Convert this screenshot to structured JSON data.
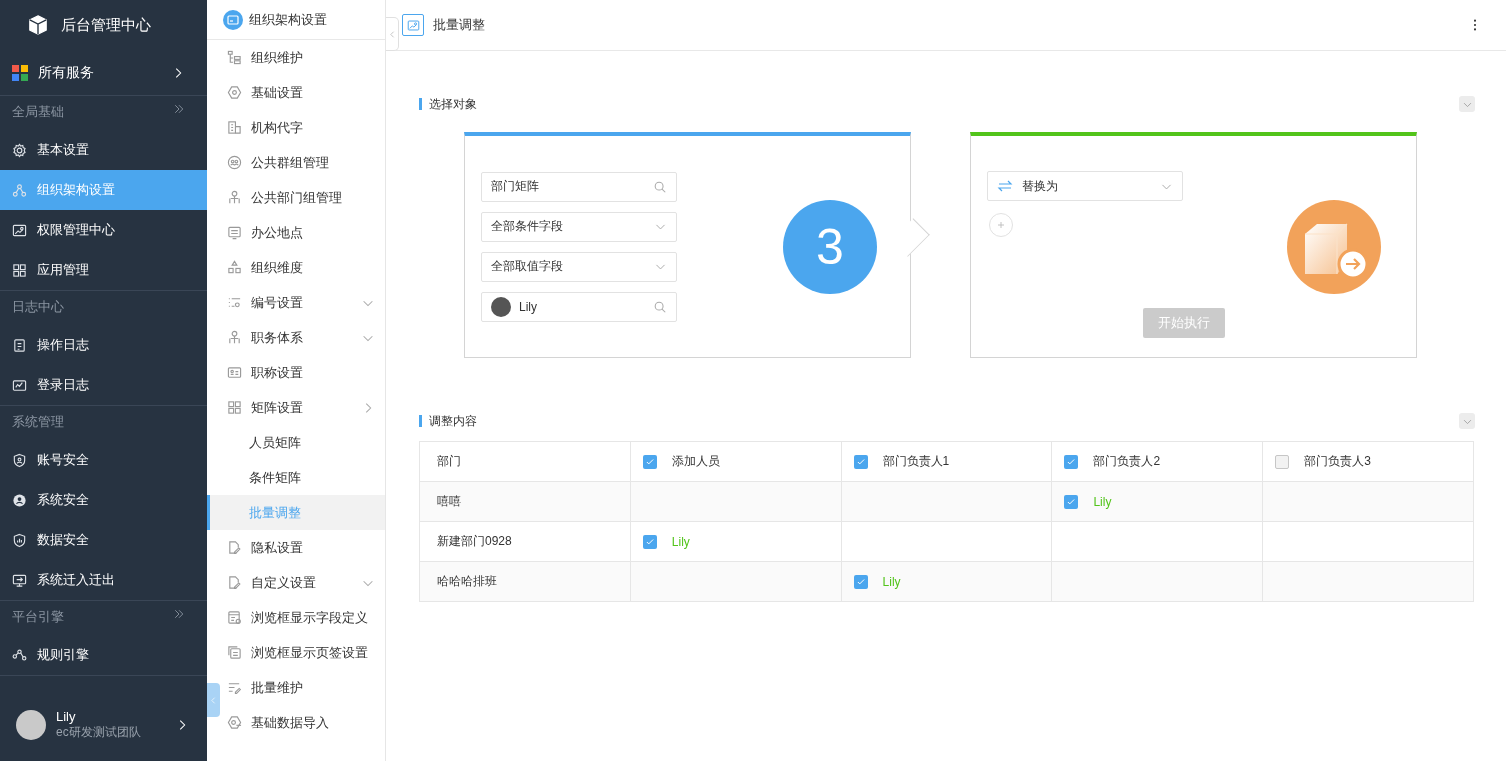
{
  "sidebar": {
    "title": "后台管理中心",
    "services": {
      "label": "所有服务"
    },
    "groups": [
      {
        "label": "全局基础",
        "items": [
          {
            "label": "基本设置",
            "selected": false
          },
          {
            "label": "组织架构设置",
            "selected": true
          },
          {
            "label": "权限管理中心",
            "selected": false
          },
          {
            "label": "应用管理",
            "selected": false
          }
        ]
      },
      {
        "label": "日志中心",
        "items": [
          {
            "label": "操作日志",
            "selected": false
          },
          {
            "label": "登录日志",
            "selected": false
          }
        ]
      },
      {
        "label": "系统管理",
        "items": [
          {
            "label": "账号安全",
            "selected": false
          },
          {
            "label": "系统安全",
            "selected": false
          },
          {
            "label": "数据安全",
            "selected": false
          },
          {
            "label": "系统迁入迁出",
            "selected": false
          }
        ]
      },
      {
        "label": "平台引擎",
        "items": [
          {
            "label": "规则引擎",
            "selected": false
          }
        ]
      }
    ],
    "user": {
      "name": "Lily",
      "team": "ec研发测试团队"
    }
  },
  "submenu": {
    "title": "组织架构设置",
    "items": [
      {
        "label": "组织维护",
        "selected": false
      },
      {
        "label": "基础设置",
        "selected": false
      },
      {
        "label": "机构代字",
        "selected": false
      },
      {
        "label": "公共群组管理",
        "selected": false
      },
      {
        "label": "公共部门组管理",
        "selected": false
      },
      {
        "label": "办公地点",
        "selected": false
      },
      {
        "label": "组织维度",
        "selected": false
      },
      {
        "label": "编号设置",
        "selected": false,
        "expanded": false
      },
      {
        "label": "职务体系",
        "selected": false,
        "expanded": false
      },
      {
        "label": "职称设置",
        "selected": false
      },
      {
        "label": "矩阵设置",
        "selected": false,
        "expanded": true,
        "children": [
          {
            "label": "人员矩阵",
            "selected": false
          },
          {
            "label": "条件矩阵",
            "selected": false
          },
          {
            "label": "批量调整",
            "selected": true
          }
        ]
      },
      {
        "label": "隐私设置",
        "selected": false
      },
      {
        "label": "自定义设置",
        "selected": false,
        "expanded": false
      },
      {
        "label": "浏览框显示字段定义",
        "selected": false
      },
      {
        "label": "浏览框显示页签设置",
        "selected": false
      },
      {
        "label": "批量维护",
        "selected": false
      },
      {
        "label": "基础数据导入",
        "selected": false
      }
    ]
  },
  "page": {
    "title": "批量调整"
  },
  "select_section": {
    "title": "选择对象",
    "fields": [
      {
        "kind": "search",
        "value": "部门矩阵"
      },
      {
        "kind": "dropdown",
        "value": "全部条件字段"
      },
      {
        "kind": "dropdown",
        "value": "全部取值字段"
      },
      {
        "kind": "user",
        "value": "Lily"
      }
    ],
    "count": "3",
    "action": {
      "value": "替换为"
    },
    "button": {
      "label": "开始执行",
      "disabled": true
    }
  },
  "adjust_section": {
    "title": "调整内容",
    "columns": [
      {
        "label": "部门"
      },
      {
        "label": "添加人员",
        "checked": true
      },
      {
        "label": "部门负责人1",
        "checked": true
      },
      {
        "label": "部门负责人2",
        "checked": true
      },
      {
        "label": "部门负责人3",
        "checked": false
      }
    ],
    "rows": [
      {
        "cells": [
          {
            "value": "嘻嘻"
          },
          {},
          {},
          {
            "checked": true,
            "value": "Lily"
          },
          {}
        ]
      },
      {
        "cells": [
          {
            "value": "新建部门0928"
          },
          {
            "checked": true,
            "value": "Lily"
          },
          {},
          {},
          {}
        ]
      },
      {
        "cells": [
          {
            "value": "哈哈哈排班"
          },
          {},
          {
            "checked": true,
            "value": "Lily"
          },
          {},
          {}
        ]
      }
    ]
  }
}
